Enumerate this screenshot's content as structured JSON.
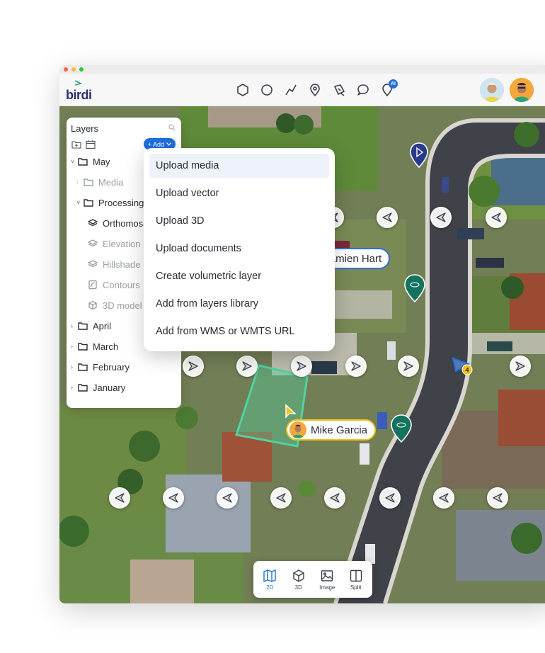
{
  "app": {
    "brand": "birdi"
  },
  "toolbar": {
    "tools": [
      "polygon-icon",
      "circle-icon",
      "line-icon",
      "location-pin-icon",
      "pen-icon",
      "comment-icon",
      "ai-icon"
    ],
    "ai_badge": "AI"
  },
  "layers": {
    "title": "Layers",
    "add_label": "+ Add",
    "tree": [
      {
        "label": "May",
        "level": 0,
        "expanded": true,
        "type": "folder"
      },
      {
        "label": "Media",
        "level": 1,
        "expanded": false,
        "type": "folder",
        "muted": true
      },
      {
        "label": "Processing",
        "level": 1,
        "expanded": true,
        "type": "folder"
      },
      {
        "label": "Orthomosaic",
        "level": 2,
        "type": "layers"
      },
      {
        "label": "Elevation",
        "level": 2,
        "type": "layers",
        "muted": true
      },
      {
        "label": "Hillshade",
        "level": 2,
        "type": "layers",
        "muted": true
      },
      {
        "label": "Contours",
        "level": 2,
        "type": "contour",
        "muted": true
      },
      {
        "label": "3D model",
        "level": 2,
        "type": "cube",
        "muted": true
      },
      {
        "label": "April",
        "level": 0,
        "expanded": false,
        "type": "folder"
      },
      {
        "label": "March",
        "level": 0,
        "expanded": false,
        "type": "folder"
      },
      {
        "label": "February",
        "level": 0,
        "expanded": false,
        "type": "folder"
      },
      {
        "label": "January",
        "level": 0,
        "expanded": false,
        "type": "folder"
      }
    ]
  },
  "add_menu": {
    "items": [
      "Upload media",
      "Upload vector",
      "Upload 3D",
      "Upload documents",
      "Create volumetric layer",
      "Add from layers library",
      "Add from WMS or WMTS URL"
    ],
    "active_index": 0
  },
  "collaborators": {
    "damien": "Damien Hart",
    "mike": "Mike Garcia"
  },
  "cluster_count": "4",
  "view_modes": [
    {
      "label": "2D",
      "icon": "map-icon",
      "active": true
    },
    {
      "label": "3D",
      "icon": "cube-icon",
      "active": false
    },
    {
      "label": "Image",
      "icon": "image-icon",
      "active": false
    },
    {
      "label": "Split",
      "icon": "split-icon",
      "active": false
    }
  ],
  "colors": {
    "accent": "#1f6fe0",
    "damien_outline": "#2f6fdc",
    "mike_outline": "#f2c21b",
    "area_polygon": "#4fd3a0",
    "pin_green": "#13735f",
    "pin_navy": "#283a8c"
  }
}
